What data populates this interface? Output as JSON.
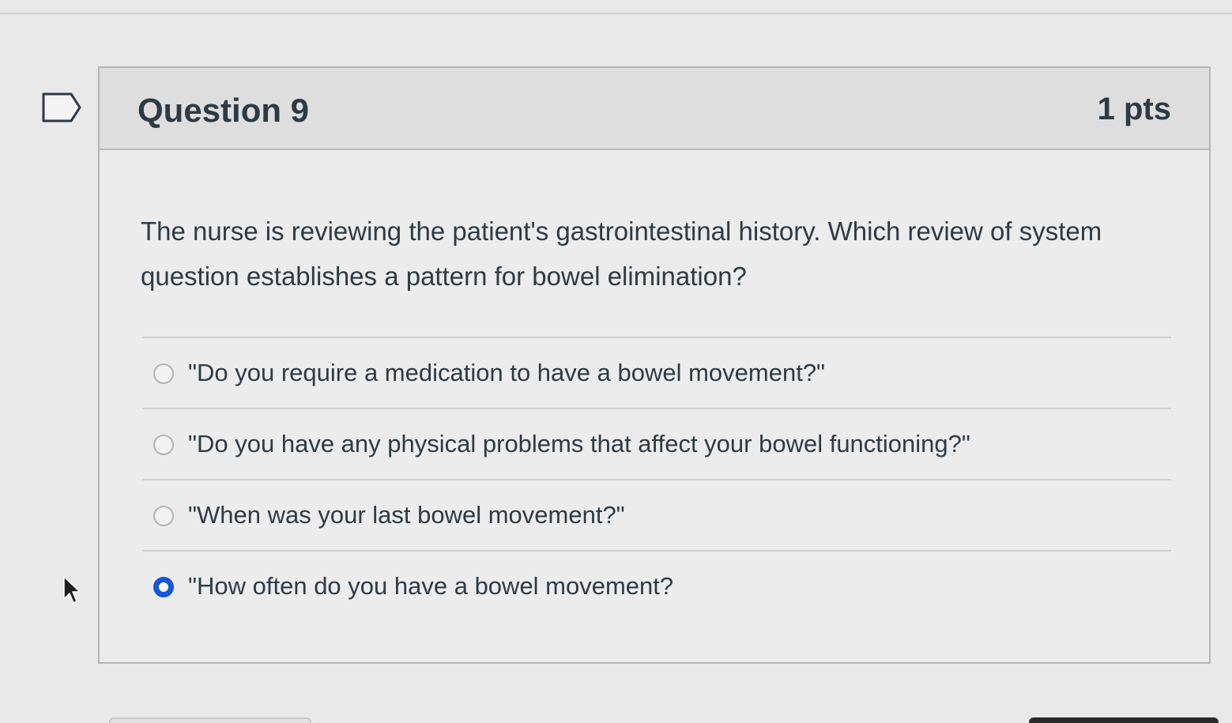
{
  "question": {
    "title": "Question 9",
    "points": "1 pts",
    "text": "The nurse is reviewing the patient's gastrointestinal history. Which review of system question establishes a pattern for bowel elimination?",
    "answers": [
      {
        "label": "\"Do you require a medication to have a bowel movement?\"",
        "selected": false
      },
      {
        "label": "\"Do you have any physical problems that affect your bowel functioning?\"",
        "selected": false
      },
      {
        "label": "\"When was your last bowel movement?\"",
        "selected": false
      },
      {
        "label": "\"How often do you have a bowel movement?",
        "selected": true
      }
    ]
  },
  "icons": {
    "flag": "flag-question-icon",
    "cursor": "mouse-pointer-icon",
    "radio_unchecked": "radio-unchecked-icon",
    "radio_checked": "radio-checked-icon"
  },
  "colors": {
    "accent": "#1557d6",
    "text": "#2d3b45",
    "header_bg": "#dedede",
    "page_bg": "#e9e9e9"
  }
}
